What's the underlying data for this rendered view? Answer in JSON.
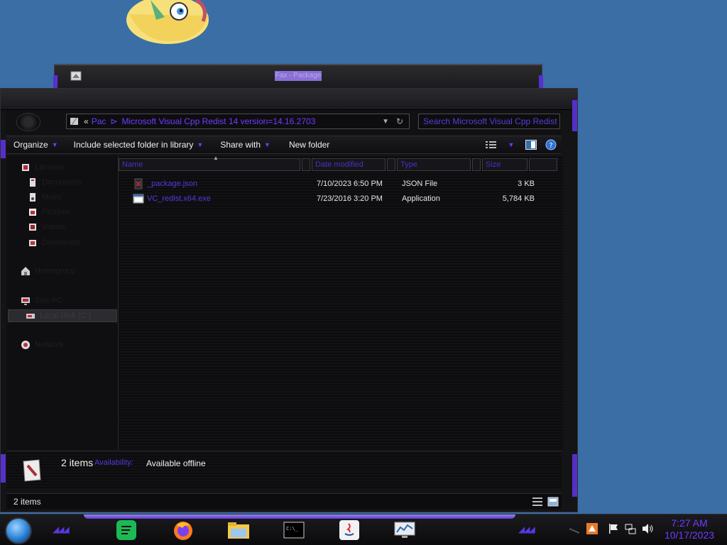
{
  "background_window": {
    "title": "Fax - Package"
  },
  "explorer": {
    "address": {
      "crumbs": [
        "Pac",
        "Microsoft Visual Cpp Redist 14 version=14.16.2703"
      ],
      "overflow": "«"
    },
    "search": {
      "placeholder": "Search Microsoft Visual Cpp Redist"
    },
    "toolbar": {
      "organize": "Organize",
      "include": "Include selected folder in library",
      "share": "Share with",
      "new_folder": "New folder"
    },
    "nav": [
      {
        "label": "Libraries",
        "icon": "library-icon"
      },
      {
        "label": "Documents",
        "icon": "documents-icon"
      },
      {
        "label": "Music",
        "icon": "music-icon"
      },
      {
        "label": "Pictures",
        "icon": "pictures-icon"
      },
      {
        "label": "Videos",
        "icon": "videos-icon"
      },
      {
        "label": "Downloads",
        "icon": "downloads-icon"
      },
      {
        "label": "Homegroup",
        "icon": "homegroup-icon"
      },
      {
        "label": "This PC",
        "icon": "computer-icon"
      },
      {
        "label": "Local Disk (C:)",
        "icon": "drive-icon"
      },
      {
        "label": "Network",
        "icon": "network-icon"
      }
    ],
    "columns": {
      "name": "Name",
      "date": "Date modified",
      "type": "Type",
      "size": "Size"
    },
    "files": [
      {
        "name": "_package.json",
        "date": "7/10/2023 6:50 PM",
        "type": "JSON File",
        "size": "3 KB",
        "icon": "json-file-icon"
      },
      {
        "name": "VC_redist.x64.exe",
        "date": "7/23/2016 3:20 PM",
        "type": "Application",
        "size": "5,784 KB",
        "icon": "exe-file-icon"
      }
    ],
    "details": {
      "count": "2 items",
      "availability_label": "Availability:",
      "availability_value": "Available offline"
    },
    "status": {
      "count": "2 items"
    }
  },
  "taskbar": {
    "apps": [
      "spotify",
      "firefox",
      "file-explorer",
      "command-prompt",
      "java",
      "resource-monitor"
    ],
    "clock": {
      "time": "7:27 AM",
      "date": "10/17/2023"
    }
  },
  "colors": {
    "accent": "#6f3cff",
    "desktop": "#3a6ea5"
  }
}
